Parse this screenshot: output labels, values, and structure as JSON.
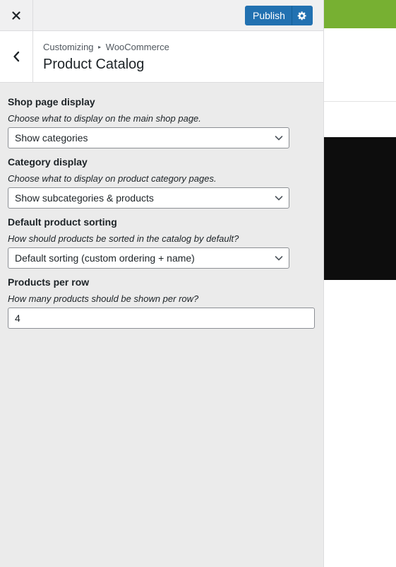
{
  "topbar": {
    "publish_label": "Publish"
  },
  "section": {
    "breadcrumb_root": "Customizing",
    "breadcrumb_sep": "▸",
    "breadcrumb_parent": "WooCommerce",
    "title": "Product Catalog"
  },
  "controls": {
    "shop_display": {
      "label": "Shop page display",
      "description": "Choose what to display on the main shop page.",
      "selected": "Show categories"
    },
    "category_display": {
      "label": "Category display",
      "description": "Choose what to display on product category pages.",
      "selected": "Show subcategories & products"
    },
    "default_sorting": {
      "label": "Default product sorting",
      "description": "How should products be sorted in the catalog by default?",
      "selected": "Default sorting (custom ordering + name)"
    },
    "products_per_row": {
      "label": "Products per row",
      "description": "How many products should be shown per row?",
      "value": "4"
    }
  },
  "colors": {
    "accent": "#2271b1",
    "preview_header": "#77b032",
    "sidebar_bg": "#ebebeb"
  },
  "icons": {
    "close": "close-icon",
    "settings": "gear-icon",
    "back": "chevron-left-icon",
    "dropdown": "chevron-down-icon"
  }
}
